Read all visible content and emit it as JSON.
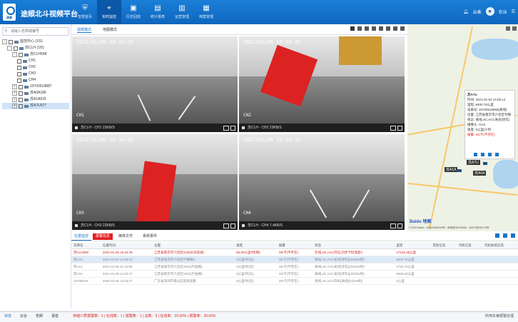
{
  "app": {
    "title": "途顺北斗视频平台",
    "logo_text": "途顺"
  },
  "nav": [
    {
      "label": "智慧首页",
      "icon": "shield-icon"
    },
    {
      "label": "实时监控",
      "icon": "location-icon"
    },
    {
      "label": "历史回放",
      "icon": "history-icon"
    },
    {
      "label": "统计报表",
      "icon": "report-icon"
    },
    {
      "label": "运营管理",
      "icon": "ops-icon"
    },
    {
      "label": "档案管理",
      "icon": "archive-icon"
    }
  ],
  "user": {
    "lang": "云乘",
    "account": "农业"
  },
  "search": {
    "placeholder": "请输入名称或编号"
  },
  "tree": [
    {
      "label": "监控中心 (1/5)",
      "level": 0,
      "exp": "-"
    },
    {
      "label": "苏CLH (1/5)",
      "level": 1,
      "exp": "-"
    },
    {
      "label": "苏CLH598",
      "level": 2,
      "exp": "-"
    },
    {
      "label": "CH1",
      "level": 3,
      "exp": ""
    },
    {
      "label": "CH2",
      "level": 3,
      "exp": ""
    },
    {
      "label": "CH3",
      "level": 3,
      "exp": ""
    },
    {
      "label": "CH4",
      "level": 3,
      "exp": ""
    },
    {
      "label": "15700619887",
      "level": 2,
      "exp": "+"
    },
    {
      "label": "苏A0A186",
      "level": 2,
      "exp": "+"
    },
    {
      "label": "苏A1A525",
      "level": 2,
      "exp": "+"
    },
    {
      "label": "苏A7U077",
      "level": 2,
      "exp": "+",
      "selected": true
    }
  ],
  "video_tabs": {
    "tab1": "视频模式",
    "tab2": "地图模式"
  },
  "cameras": [
    {
      "timestamp": "2021/01/06 16:34:35",
      "channel": "CH1",
      "status": "苏CLH - CH1 23KB/S"
    },
    {
      "timestamp": "2021/01/06 16:34:35",
      "channel": "CH2",
      "status": "苏CLH - CH2 23KB/S"
    },
    {
      "timestamp": "2021/01/06 16:34:35",
      "channel": "CH3",
      "status": "苏CLH - CH3 22KB/S"
    },
    {
      "timestamp": "2021/01/06 16:34:35",
      "channel": "CH4",
      "status": "苏CLH - CH4 7.4KB/S"
    }
  ],
  "map": {
    "info": {
      "plate": "苏A7U",
      "lines": [
        "时间: 2021-01-04 14:06:12",
        "里程: 8400.76公里",
        "设备号: 15700619886(离线)",
        "位置: 江苏省南京市六合区竹镇",
        "状态: 离线,4G,ACC关闭(停车)",
        "摄像头: CH3",
        "速度: 0公里/小时"
      ],
      "alarm": "报警: SD卡(不存在)"
    },
    "markers": [
      "苏A1A",
      "苏A7U",
      "苏A0A"
    ],
    "logo": "Baidu 地图",
    "copyright": "© 2021 Baidu - GS(2019)5218号 - 甲测资字1100930 - 京ICP证030173号"
  },
  "bottom_tabs": [
    "位置监控",
    "报警信息",
    "媒体文件",
    "系统事件"
  ],
  "table": {
    "headers": [
      "车牌号",
      "位置时间",
      "位置",
      "速度",
      "报警",
      "状态",
      "里程",
      "其他信息",
      "司机信息",
      "司机执照信息"
    ],
    "rows": [
      [
        "苏CLH598",
        "2021-01-06 16:34:25",
        "江苏省南京市六合区G25(长深高速)",
        "86.00公里/时(南)",
        "SD卡(不存在)",
        "在线,4G,ACC开启,同步卡好温度4",
        "17128.38公里",
        "",
        "",
        ""
      ],
      [
        "苏A7U",
        "2021-01-04 14:06:12",
        "江苏省南京市六合区竹镇镇S",
        "0公里/时(北)",
        "SD卡(不存在)",
        "离线,4G,ACC关闭(停车)[30分52秒]",
        "8400.76公里",
        "",
        "",
        ""
      ],
      [
        "苏A1A",
        "2021-01-05 11:15:08",
        "江苏省南京市六合区X031(竹金路)",
        "0公里/时(北)",
        "SD卡(不存在)",
        "离线,4G,ACC关闭(停车)[30分52秒]",
        "4720.70公里",
        "",
        "",
        ""
      ],
      [
        "苏A0A",
        "2021-01-05 14:20:47",
        "江苏省南京市六合区X031(竹金路)",
        "0公里/时(东)",
        "SD卡(不存在)",
        "离线,4G,ACC关闭(停车)[30分52秒]",
        "6526.52公里",
        "",
        "",
        ""
      ],
      [
        "15700619",
        "2020-10-30 13:03:27",
        "广东省深圳市南山区后海滨路",
        "0公里/时(北)",
        "SD卡(不存在)",
        "离线,4G,ACC开机(离线)[2分36秒]",
        "0公里",
        "",
        "",
        ""
      ]
    ]
  },
  "footer": {
    "tabs": [
      "状态",
      "云台",
      "告刷",
      "语音"
    ],
    "stats": "存储介质报警数：1 | 在线数：1 | 报警数：1 | 总数：5 | 在线率：20.00% | 报警率：20.00%",
    "right": "所用车辆报警处理"
  }
}
